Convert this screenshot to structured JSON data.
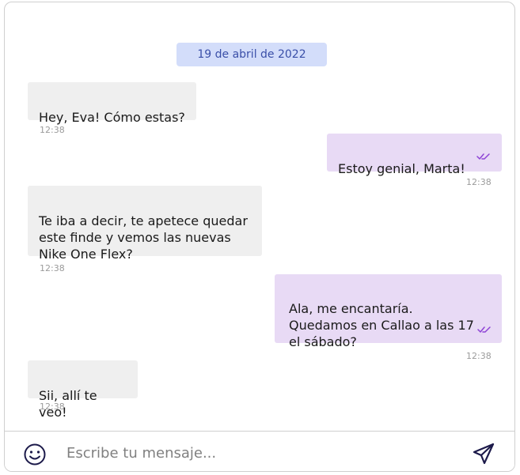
{
  "date_divider": "19 de abril de 2022",
  "messages": [
    {
      "text": "Hey, Eva! Cómo estas?",
      "time": "12:38",
      "direction": "incoming"
    },
    {
      "text": "Estoy genial, Marta!",
      "time": "12:38",
      "direction": "outgoing",
      "status_icon": "double-check-icon"
    },
    {
      "text": "Te iba a decir, te apetece quedar\neste finde y vemos las nuevas\nNike One Flex?",
      "time": "12:38",
      "direction": "incoming"
    },
    {
      "text": "Ala, me encantaría.\nQuedamos en Callao a las 17\nel sábado?",
      "time": "12:38",
      "direction": "outgoing",
      "status_icon": "double-check-icon"
    },
    {
      "text": "Sii, allí te veo!",
      "time": "12:38",
      "direction": "incoming"
    }
  ],
  "composer": {
    "placeholder": "Escribe tu mensaje...",
    "value": "",
    "emoji_icon": "smiley-icon",
    "send_icon": "paper-plane-icon"
  },
  "colors": {
    "incoming_bubble": "#efefef",
    "outgoing_bubble": "#e8daf5",
    "date_pill": "#d3ddfa",
    "check_mark": "#8e44d6"
  }
}
